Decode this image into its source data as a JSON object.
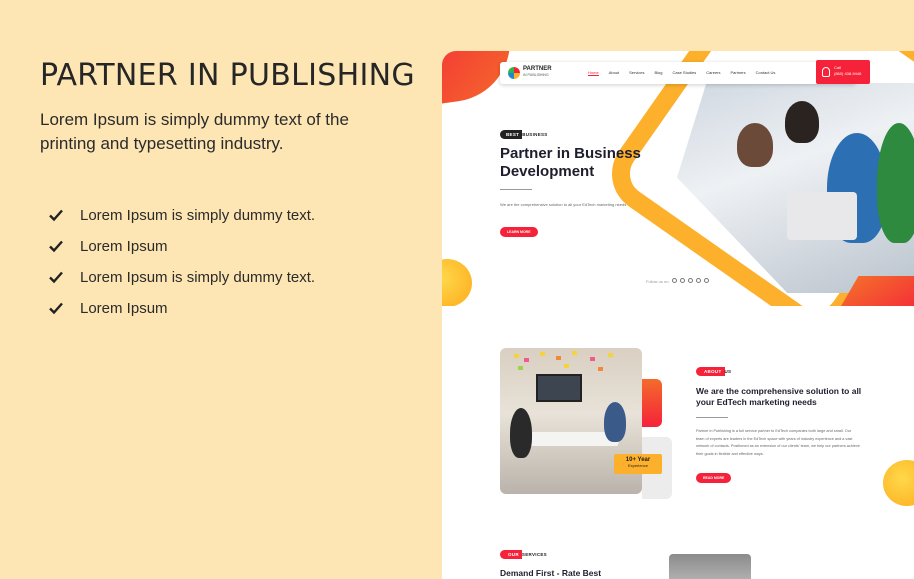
{
  "promo": {
    "title": "PARTNER IN PUBLISHING",
    "subtitle": "Lorem Ipsum is simply dummy text of the printing and typesetting industry.",
    "features": [
      {
        "icon": "check-icon",
        "text": "Lorem Ipsum is simply dummy text."
      },
      {
        "icon": "check-icon",
        "text": "Lorem Ipsum"
      },
      {
        "icon": "check-icon",
        "text": "Lorem Ipsum is simply dummy text."
      },
      {
        "icon": "check-icon",
        "text": "Lorem Ipsum"
      }
    ]
  },
  "site": {
    "logo": {
      "name": "PARTNER",
      "tagline": "IN PUBLISHING"
    },
    "nav": [
      "Home",
      "About",
      "Services",
      "Blog",
      "Case Studies",
      "Careers",
      "Partners",
      "Contact Us"
    ],
    "active_nav": "Home",
    "call": {
      "label": "Call",
      "number": "(860) 438-9446"
    },
    "hero": {
      "badge_dark": "BEST",
      "badge_rest": "BUSINESS",
      "title": "Partner in Business Development",
      "description": "We are the comprehensive solution to all your EdTech marketing needs",
      "button": "LEARN MORE",
      "follow": "Follow us on:"
    },
    "about": {
      "badge_red": "ABOUT",
      "badge_rest": "US",
      "title": "We are the comprehensive solution to all your EdTech marketing needs",
      "description": "Partner in Publishing is a full service partner to EdTech companies both large and small. Our team of experts are leaders in the EdTech space with years of industry experience and a vast network of contacts. Positioned as an extension of our clients' team, we help our partners achieve their goals in flexible and effective ways.",
      "button": "READ MORE",
      "experience_number": "10+ Year",
      "experience_label": "Experience"
    },
    "services": {
      "badge_red": "OUR",
      "badge_rest": "SERVICES",
      "title": "Demand First - Rate Best"
    }
  },
  "colors": {
    "background": "#fde6b4",
    "accent_red": "#f5223a",
    "accent_orange": "#fdb02b",
    "text_dark": "#1e1e2e"
  }
}
